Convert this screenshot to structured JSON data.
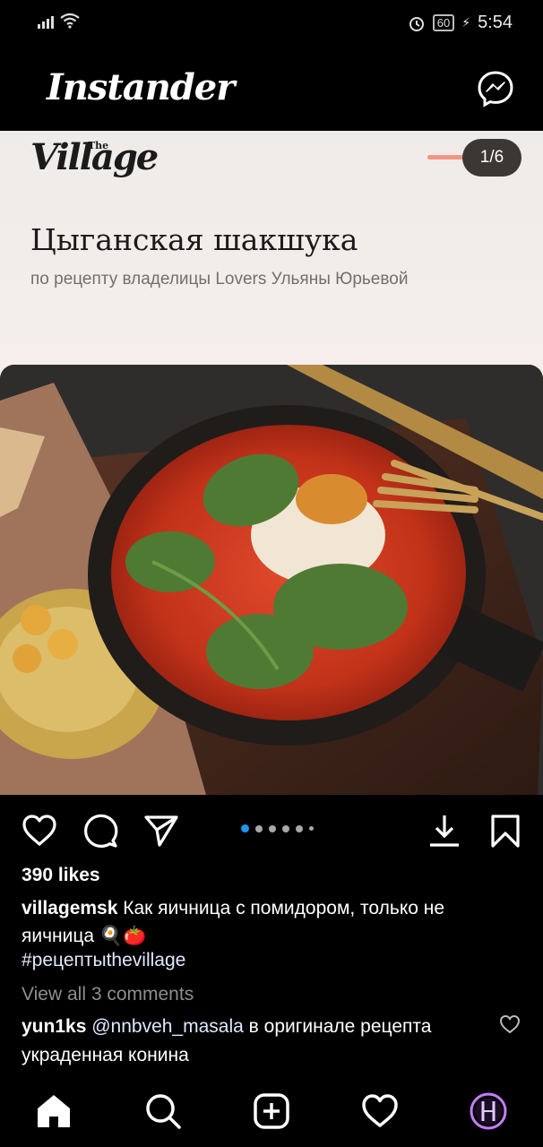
{
  "status_bar": {
    "time": "5:54",
    "battery": "60"
  },
  "app": {
    "title": "Instander"
  },
  "post": {
    "brand_the": "The",
    "brand_name": "Village",
    "slide_counter": "1/6",
    "heading": "Цыганская шакшука",
    "subheading": "по рецепту владелицы Lovers Ульяны Юрьевой",
    "carousel": {
      "total": 5,
      "active": 0
    },
    "likes": "390 likes",
    "caption_user": "villagemsk",
    "caption_text": "Как яичница с помидором, только не яичница 🍳🍅",
    "hashtag": "#рецептыthevillage",
    "view_comments": "View all 3 comments",
    "comment_user": "yun1ks",
    "comment_mention": "@nnbveh_masala",
    "comment_text": "в оригинале рецепта украденная конина"
  },
  "colors": {
    "accent_blue": "#1d97f0",
    "progress": "#f19584",
    "profile_ring": "#c77dff"
  }
}
